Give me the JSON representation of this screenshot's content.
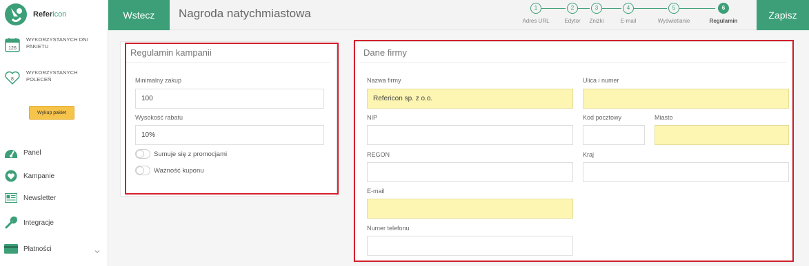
{
  "brand": {
    "name_a": "Refer",
    "name_b": "icon",
    "accent": "#3c9f78",
    "highlight": "#d21f2b",
    "yellow": "#fdf5b2"
  },
  "sidebar": {
    "stats": [
      {
        "icon": "calendar-icon",
        "badge": "126",
        "label": "WYKORZYSTANYCH DNI PAKIETU"
      },
      {
        "icon": "heart-icon",
        "badge": "8",
        "label": "WYKORZYSTANYCH POLECEŃ"
      }
    ],
    "buy_label": "Wykup pakiet",
    "nav": [
      {
        "icon": "dashboard-icon",
        "label": "Panel"
      },
      {
        "icon": "heart-icon",
        "label": "Kampanie"
      },
      {
        "icon": "newsletter-icon",
        "label": "Newsletter"
      },
      {
        "icon": "wrench-icon",
        "label": "Integracje"
      },
      {
        "icon": "credit-card-icon",
        "label": "Płatności"
      }
    ]
  },
  "topbar": {
    "back_label": "Wstecz",
    "title": "Nagroda natychmiastowa",
    "save_label": "Zapisz",
    "steps": [
      {
        "num": "1",
        "label": "Adres URL"
      },
      {
        "num": "2",
        "label": "Edytor"
      },
      {
        "num": "3",
        "label": "Zniżki"
      },
      {
        "num": "4",
        "label": "E-mail"
      },
      {
        "num": "5",
        "label": "Wyświetlanie"
      },
      {
        "num": "6",
        "label": "Regulamin"
      }
    ],
    "active_step": 6
  },
  "rules_panel": {
    "title": "Regulamin kampanii",
    "min_purchase_label": "Minimalny zakup",
    "min_purchase_value": "100",
    "discount_label": "Wysokość rabatu",
    "discount_value": "10%",
    "toggle_promo_label": "Sumuje się z promocjami",
    "toggle_validity_label": "Ważność kuponu"
  },
  "company_panel": {
    "title": "Dane firmy",
    "company_name_label": "Nazwa firmy",
    "company_name_value": "Refericon sp. z o.o.",
    "street_label": "Ulica i numer",
    "street_value": "",
    "nip_label": "NIP",
    "nip_value": "",
    "postal_label": "Kod pocztowy",
    "postal_value": "",
    "city_label": "Miasto",
    "city_value": "",
    "regon_label": "REGON",
    "regon_value": "",
    "country_label": "Kraj",
    "country_value": "",
    "email_label": "E-mail",
    "email_value": "",
    "phone_label": "Numer telefonu",
    "phone_value": ""
  }
}
